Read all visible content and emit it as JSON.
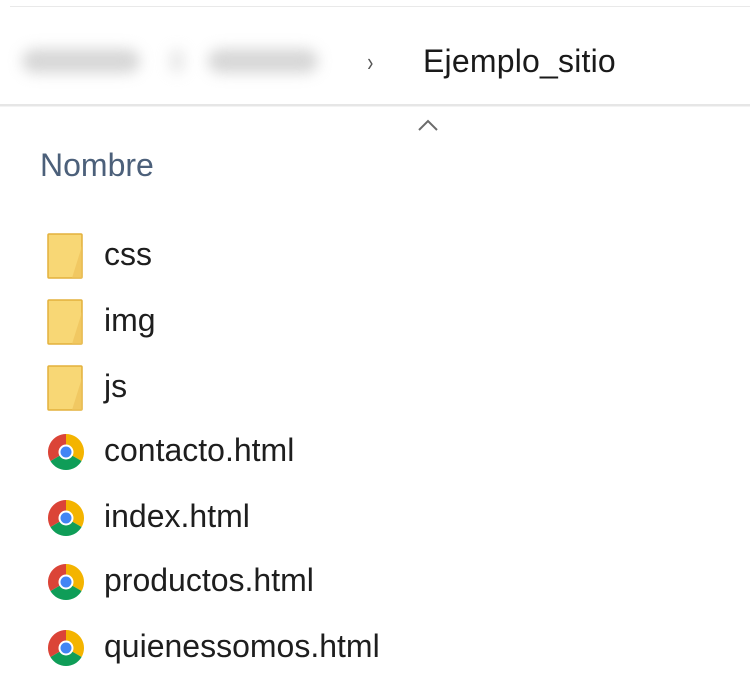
{
  "breadcrumb": {
    "current": "Ejemplo_sitio",
    "separator": "›"
  },
  "columns": {
    "name_header": "Nombre",
    "sort_direction": "ascending"
  },
  "files": [
    {
      "name": "css",
      "type": "folder"
    },
    {
      "name": "img",
      "type": "folder"
    },
    {
      "name": "js",
      "type": "folder"
    },
    {
      "name": "contacto.html",
      "type": "chrome-html"
    },
    {
      "name": "index.html",
      "type": "chrome-html"
    },
    {
      "name": "productos.html",
      "type": "chrome-html"
    },
    {
      "name": "quienessomos.html",
      "type": "chrome-html"
    }
  ],
  "icons": {
    "folder": "folder-icon",
    "html": "chrome-html-file-icon",
    "sort": "sort-ascending-caret-icon",
    "separator": "chevron-right-icon"
  },
  "colors": {
    "folder_fill": "#f8d775",
    "folder_edge": "#e3b13c",
    "header_text": "#4c607a",
    "chrome_red": "#db4437",
    "chrome_green": "#0f9d58",
    "chrome_yellow": "#f4b400",
    "chrome_blue": "#4285f4"
  }
}
